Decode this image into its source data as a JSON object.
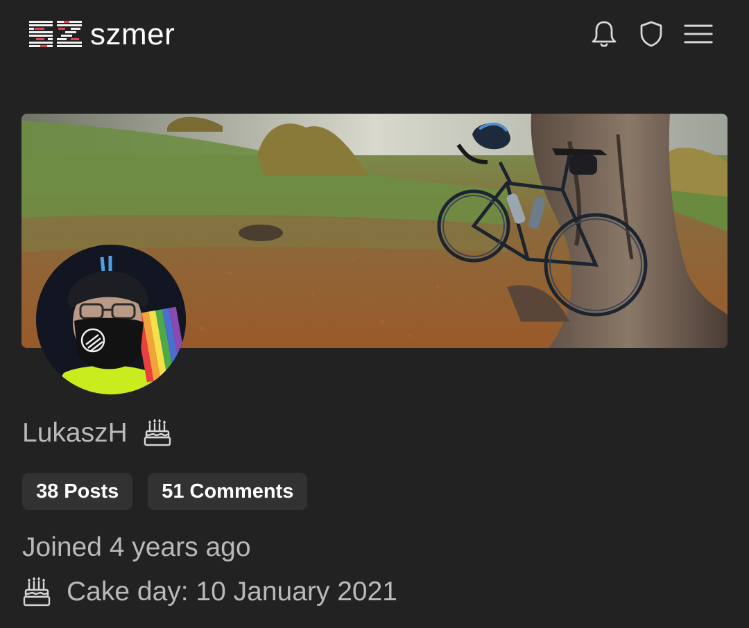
{
  "header": {
    "site_name": "szmer",
    "logo_text": "SZ",
    "icons": [
      "bell-icon",
      "shield-icon",
      "hamburger-menu-icon"
    ]
  },
  "profile": {
    "username": "LukaszH",
    "posts_count": "38",
    "posts_label": "Posts",
    "comments_count": "51",
    "comments_label": "Comments",
    "joined": "Joined 4 years ago",
    "cake_day": "Cake day: 10 January 2021",
    "banner": "banner-image",
    "avatar": "avatar-image"
  },
  "colors": {
    "background": "#222222",
    "pill_background": "#323232",
    "muted_text": "#b9b9b9",
    "title_text": "#ffffff",
    "logo_accent": "#d94a5a"
  }
}
